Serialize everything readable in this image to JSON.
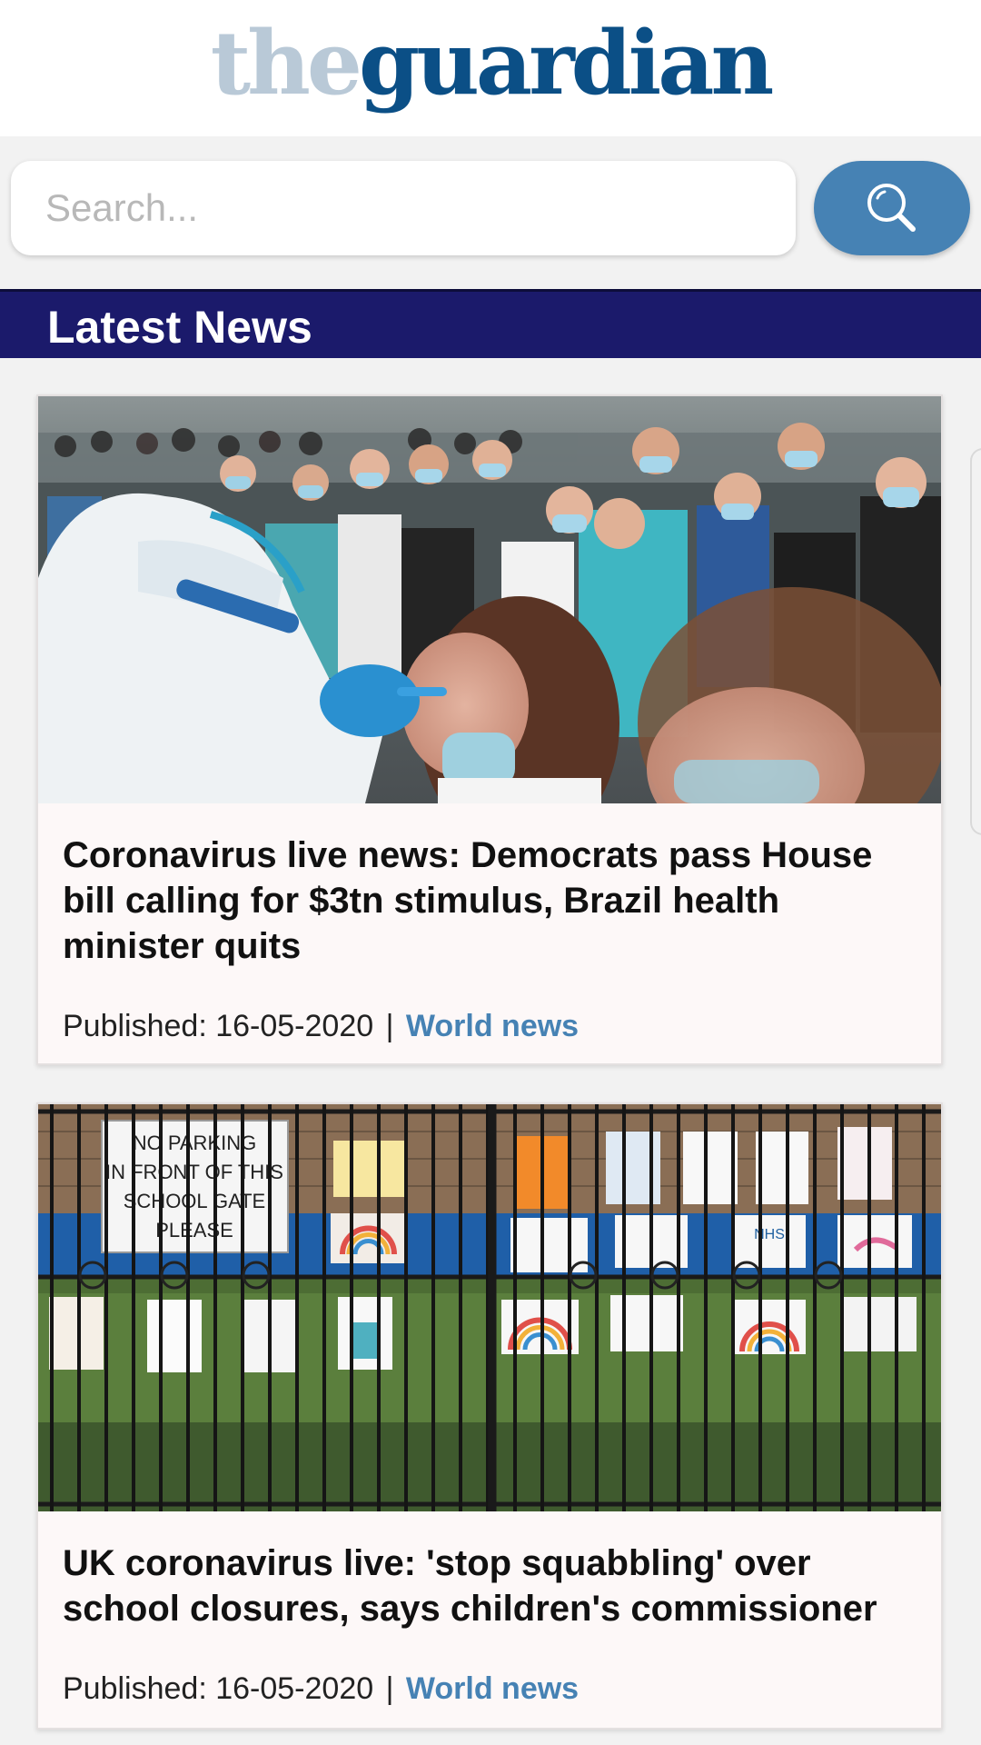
{
  "header": {
    "logo_the": "the",
    "logo_guardian": "guardian",
    "colors": {
      "the": "#b9c9d7",
      "guardian": "#0b4f86"
    }
  },
  "search": {
    "placeholder": "Search...",
    "button_icon": "search-icon",
    "button_color": "#4682b4"
  },
  "section": {
    "title": "Latest News",
    "background": "#1b1a6b"
  },
  "articles": [
    {
      "title": "Coronavirus live news: Democrats pass House bill calling for $3tn stimulus, Brazil health minister quits",
      "published_label": "Published: 16-05-2020",
      "separator": "|",
      "category": "World news",
      "image": "photo of masked people queuing while a health worker in protective suit swabs a woman's throat"
    },
    {
      "title": "UK coronavirus live: 'stop squabbling' over school closures, says children's commissioner",
      "published_label": "Published: 16-05-2020",
      "separator": "|",
      "category": "World news",
      "image": "photo of children's drawings and rainbows hung on a school gate",
      "sign_text": "NO PARKING IN FRONT OF THIS SCHOOL GATE PLEASE",
      "drawing_text": "NHS"
    }
  ]
}
